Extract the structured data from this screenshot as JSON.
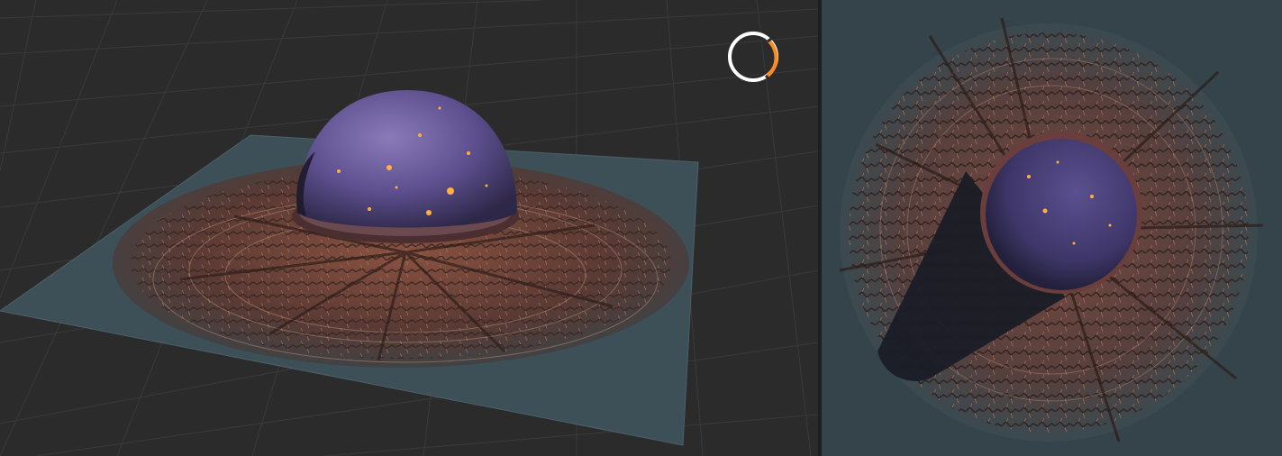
{
  "viewport_perspective": {
    "kind": "3D perspective viewport",
    "grid": true,
    "status_indicator": {
      "icon": "loading-ring-icon",
      "progress": 0.2
    }
  },
  "viewport_top": {
    "kind": "top-down render view"
  },
  "colors": {
    "background": "#2b2b2b",
    "grid": "#3a3a3a",
    "terrain_base": "#3e5058",
    "rock": "#7a4a3a",
    "dome": "#6a5a98",
    "glow": "#ffb040",
    "progress_accent": "#ff8a1c",
    "ring": "#ffffff"
  }
}
